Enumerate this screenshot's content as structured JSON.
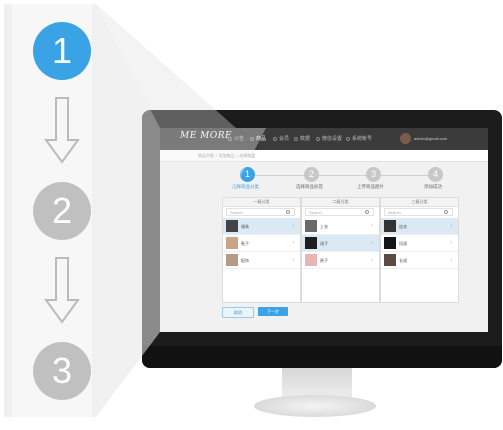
{
  "steps": [
    "1",
    "2",
    "3"
  ],
  "app": {
    "logo": "ME MORE",
    "nav": [
      "公告",
      "商品",
      "会员",
      "数据",
      "微信设置",
      "系统帐号"
    ],
    "user": "admin@gmail.com",
    "breadcrumb": "商品列表 > 添加商品 > 选择商品"
  },
  "progress": [
    {
      "num": "1",
      "label": "选择商品分类"
    },
    {
      "num": "2",
      "label": "选择商品标签"
    },
    {
      "num": "3",
      "label": "上传商品图片"
    },
    {
      "num": "4",
      "label": "添加成功"
    }
  ],
  "panels": [
    {
      "title": "一级分类",
      "search": "Search",
      "rows": [
        {
          "label": "服装",
          "selected": true
        },
        {
          "label": "鞋子",
          "selected": false
        },
        {
          "label": "配饰",
          "selected": false
        }
      ]
    },
    {
      "title": "二级分类",
      "search": "Search",
      "rows": [
        {
          "label": "上衣",
          "selected": false
        },
        {
          "label": "裙子",
          "selected": true
        },
        {
          "label": "裤子",
          "selected": false
        }
      ]
    },
    {
      "title": "三级分类",
      "search": "Search",
      "rows": [
        {
          "label": "连衣",
          "selected": true
        },
        {
          "label": "短裙",
          "selected": false
        },
        {
          "label": "长裙",
          "selected": false
        }
      ]
    }
  ],
  "buttons": {
    "cancel": "取消",
    "next": "下一步"
  },
  "colors": {
    "accent": "#3aa3e5",
    "inactive": "#c0c0c0",
    "screen_bg": "#f1f1f1",
    "header_bg": "#3b3b3b"
  }
}
